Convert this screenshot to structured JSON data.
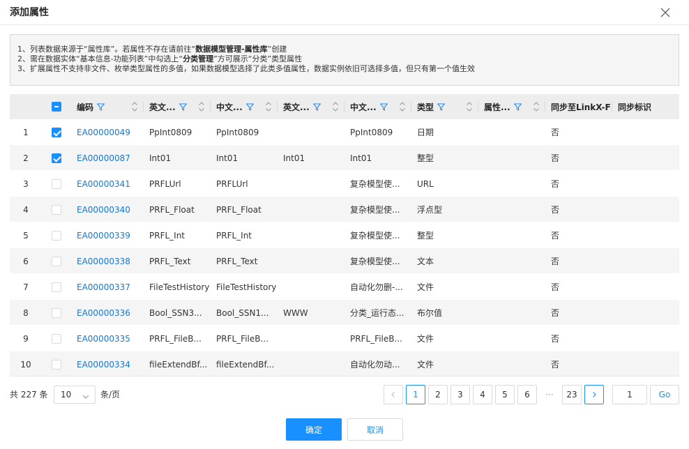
{
  "dialog": {
    "title": "添加属性",
    "close_icon": "close-icon"
  },
  "notice": {
    "line1": {
      "pre": "1、列表数据来源于“属性库”。若属性不存在请前往“",
      "bold": "数据模型管理-属性库",
      "post": "”创建"
    },
    "line2": {
      "pre": "2、需在数据实体“基本信息-功能列表”中勾选上“",
      "bold": "分类管理",
      "post": "”方可展示“分类”类型属性"
    },
    "line3": {
      "text": "3、扩展属性不支持非文件、枚举类型属性的多值，如果数据模型选择了此类多值属性，数据实例依旧可选择多值，但只有第一个值生效"
    }
  },
  "table": {
    "headers": {
      "code": "编码",
      "en_name": "英文...",
      "cn_name": "中文...",
      "en_desc": "英文...",
      "cn_desc": "中文...",
      "type": "类型",
      "attr": "属性...",
      "sync": "同步至LinkX-F",
      "sync_flag": "同步标识"
    },
    "header_checkbox_state": "indeterminate",
    "rows": [
      {
        "index": "1",
        "checked": true,
        "code": "EA00000049",
        "en_name": "PpInt0809",
        "cn_name": "PpInt0809",
        "en_desc": "",
        "cn_desc": "PpInt0809",
        "type": "日期",
        "sync": "否"
      },
      {
        "index": "2",
        "checked": true,
        "code": "EA00000087",
        "en_name": "Int01",
        "cn_name": "Int01",
        "en_desc": "Int01",
        "cn_desc": "Int01",
        "type": "整型",
        "sync": "否"
      },
      {
        "index": "3",
        "checked": false,
        "code": "EA00000341",
        "en_name": "PRFLUrl",
        "cn_name": "PRFLUrl",
        "en_desc": "",
        "cn_desc": "复杂模型使...",
        "type": "URL",
        "sync": "否"
      },
      {
        "index": "4",
        "checked": false,
        "code": "EA00000340",
        "en_name": "PRFL_Float",
        "cn_name": "PRFL_Float",
        "en_desc": "",
        "cn_desc": "复杂模型使...",
        "type": "浮点型",
        "sync": "否"
      },
      {
        "index": "5",
        "checked": false,
        "code": "EA00000339",
        "en_name": "PRFL_Int",
        "cn_name": "PRFL_Int",
        "en_desc": "",
        "cn_desc": "复杂模型使...",
        "type": "整型",
        "sync": "否"
      },
      {
        "index": "6",
        "checked": false,
        "code": "EA00000338",
        "en_name": "PRFL_Text",
        "cn_name": "PRFL_Text",
        "en_desc": "",
        "cn_desc": "复杂模型使...",
        "type": "文本",
        "sync": "否"
      },
      {
        "index": "7",
        "checked": false,
        "code": "EA00000337",
        "en_name": "FileTestHistory",
        "cn_name": "FileTestHistory",
        "en_desc": "",
        "cn_desc": "自动化勿删-...",
        "type": "文件",
        "sync": "否"
      },
      {
        "index": "8",
        "checked": false,
        "code": "EA00000336",
        "en_name": "Bool_SSN3...",
        "cn_name": "Bool_SSN1...",
        "en_desc": "WWW",
        "cn_desc": "分类_运行态...",
        "type": "布尔值",
        "sync": "否"
      },
      {
        "index": "9",
        "checked": false,
        "code": "EA00000335",
        "en_name": "PRFL_FileB...",
        "cn_name": "PRFL_FileB...",
        "en_desc": "",
        "cn_desc": "PRFL_FileB...",
        "type": "文件",
        "sync": "否"
      },
      {
        "index": "10",
        "checked": false,
        "code": "EA00000334",
        "en_name": "fileExtendBf...",
        "cn_name": "fileExtendBf...",
        "en_desc": "",
        "cn_desc": "自动化勿动...",
        "type": "文件",
        "sync": "否"
      }
    ]
  },
  "pagination": {
    "total": "共 227 条",
    "page_size": "10",
    "per_page": "条/页",
    "pages": [
      "1",
      "2",
      "3",
      "4",
      "5",
      "6"
    ],
    "ellipsis": "···",
    "last": "23",
    "current": "1",
    "jump_value": "1",
    "go": "Go"
  },
  "footer": {
    "ok": "确定",
    "cancel": "取消"
  },
  "colors": {
    "primary": "#1890ff",
    "link": "#1677d2",
    "header_bg": "#ededed",
    "alt_row": "#f5f5f5"
  }
}
